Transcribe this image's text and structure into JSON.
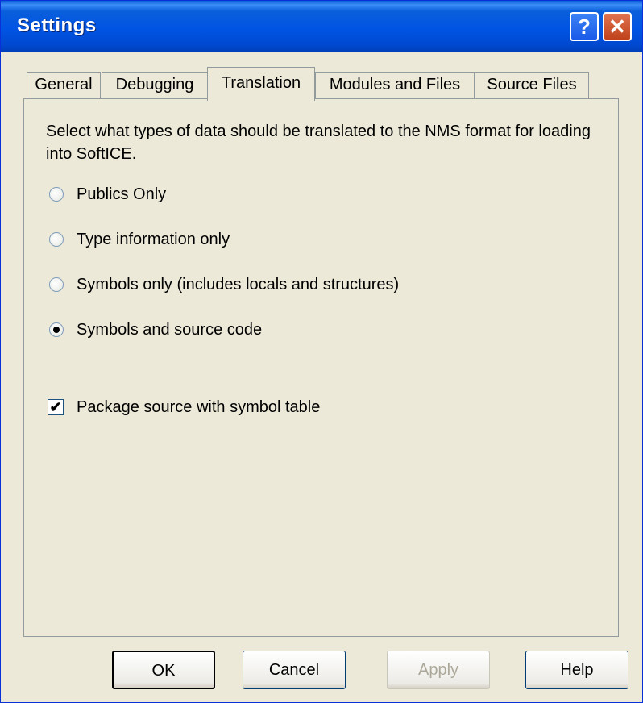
{
  "window": {
    "title": "Settings",
    "help_glyph": "?",
    "close_glyph": "✕"
  },
  "tabs": [
    {
      "label": "General",
      "active": false
    },
    {
      "label": "Debugging",
      "active": false
    },
    {
      "label": "Translation",
      "active": true
    },
    {
      "label": "Modules and Files",
      "active": false
    },
    {
      "label": "Source Files",
      "active": false
    }
  ],
  "translation": {
    "description": "Select what types of data should be translated to the NMS format for loading into SoftICE.",
    "options": [
      {
        "label": "Publics Only",
        "selected": false
      },
      {
        "label": "Type information only",
        "selected": false
      },
      {
        "label": "Symbols only (includes locals and structures)",
        "selected": false
      },
      {
        "label": "Symbols and source code",
        "selected": true
      }
    ],
    "package_source": {
      "label": "Package source with symbol table",
      "checked": true,
      "check_glyph": "✔"
    }
  },
  "buttons": {
    "ok": "OK",
    "cancel": "Cancel",
    "apply": "Apply",
    "help": "Help"
  }
}
